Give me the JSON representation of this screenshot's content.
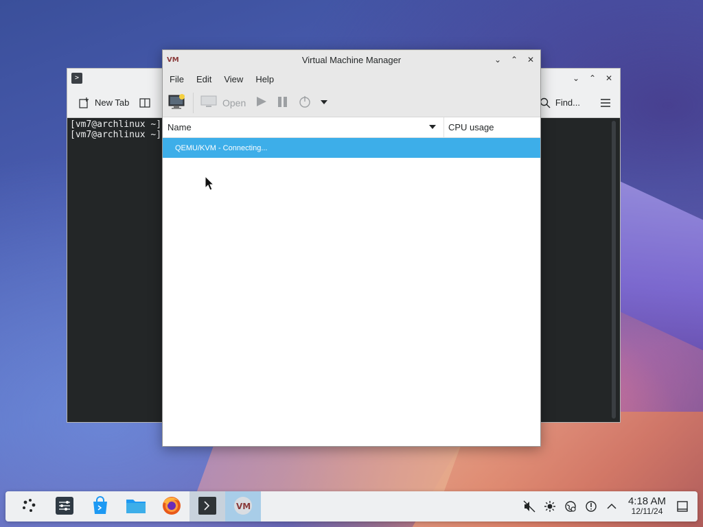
{
  "terminal": {
    "toolbar": {
      "new_tab_label": "New Tab",
      "find_label": "Find..."
    },
    "lines": [
      "[vm7@archlinux ~]",
      "[vm7@archlinux ~]"
    ]
  },
  "vmm": {
    "title": "Virtual Machine Manager",
    "menu": [
      "File",
      "Edit",
      "View",
      "Help"
    ],
    "toolbar": {
      "open_label": "Open"
    },
    "columns": {
      "name": "Name",
      "cpu": "CPU usage"
    },
    "rows": [
      {
        "label": "QEMU/KVM - Connecting..."
      }
    ]
  },
  "taskbar": {
    "clock": {
      "time": "4:18 AM",
      "date": "12/11/24"
    }
  },
  "colors": {
    "accent": "#3daee9",
    "terminal_bg": "#232627"
  }
}
